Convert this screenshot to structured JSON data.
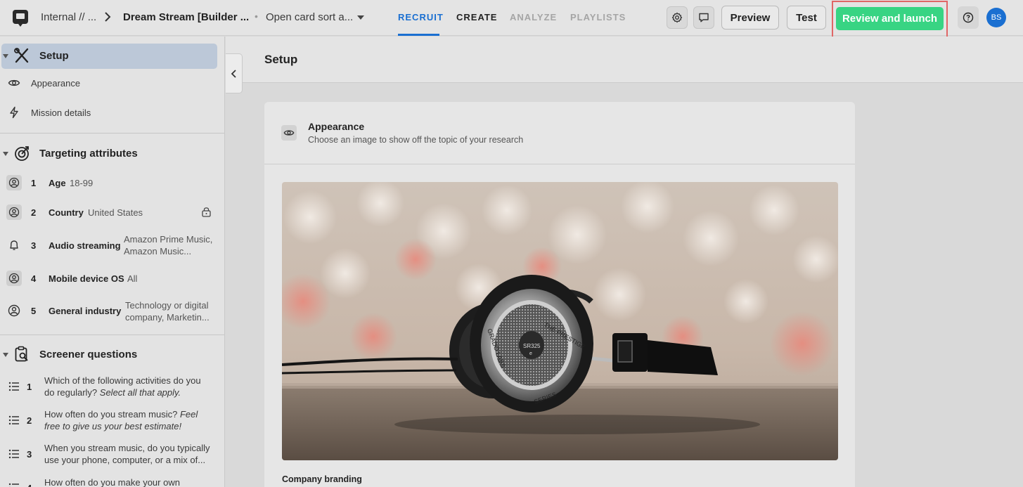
{
  "header": {
    "project": "Internal // ...",
    "study": "Dream Stream [Builder ...",
    "study_type": "Open card sort a...",
    "tabs": [
      {
        "label": "RECRUIT",
        "state": "active"
      },
      {
        "label": "CREATE",
        "state": "normal"
      },
      {
        "label": "ANALYZE",
        "state": "disabled"
      },
      {
        "label": "PLAYLISTS",
        "state": "disabled"
      }
    ],
    "preview_label": "Preview",
    "test_label": "Test",
    "launch_label": "Review and launch",
    "avatar_initials": "BS"
  },
  "sidebar": {
    "setup": {
      "title": "Setup",
      "items": [
        {
          "label": "Appearance",
          "icon": "eye-icon"
        },
        {
          "label": "Mission details",
          "icon": "lightning-icon"
        }
      ]
    },
    "targeting": {
      "title": "Targeting attributes",
      "items": [
        {
          "num": "1",
          "name": "Age",
          "value": "18-99",
          "icon": "user-circle-icon"
        },
        {
          "num": "2",
          "name": "Country",
          "value": "United States",
          "icon": "user-circle-icon",
          "locked": true
        },
        {
          "num": "3",
          "name": "Audio streaming",
          "value_line1": "Amazon Prime Music,",
          "value_line2": "Amazon Music...",
          "icon": "bell-icon"
        },
        {
          "num": "4",
          "name": "Mobile device OS",
          "value": "All",
          "icon": "user-circle-icon"
        },
        {
          "num": "5",
          "name": "General industry",
          "value_line1": "Technology or digital",
          "value_line2": "company, Marketin...",
          "icon": "person-icon"
        }
      ]
    },
    "screener": {
      "title": "Screener questions",
      "items": [
        {
          "num": "1",
          "text": "Which of the following activities do you do regularly?",
          "hint": "Select all that apply."
        },
        {
          "num": "2",
          "text": "How often do you stream music?",
          "hint": "Feel free to give us your best estimate!"
        },
        {
          "num": "3",
          "text": "When you stream music, do you typically use your phone, computer, or a mix of...",
          "hint": ""
        },
        {
          "num": "4",
          "text": "How often do you make your own",
          "hint": ""
        }
      ]
    }
  },
  "main": {
    "page_title": "Setup",
    "card": {
      "title": "Appearance",
      "subtitle": "Choose an image to show off the topic of your research",
      "image_alt": "Headphones on a wooden table",
      "headphone_text_top": "THE PRESTIGE",
      "headphone_text_side": "GRADO LABS",
      "headphone_text_bottom": "SERIES",
      "headphone_model": "SR325",
      "headphone_badge": "e",
      "branding_label": "Company branding"
    }
  },
  "colors": {
    "accent": "#1a6fd1",
    "launch": "#38d483",
    "highlight_frame": "#e06666",
    "selected_row": "#bcc8d8"
  }
}
